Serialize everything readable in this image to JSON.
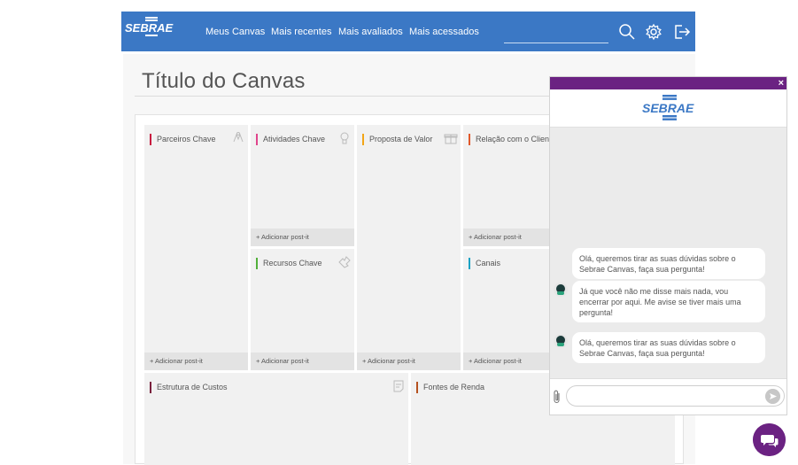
{
  "brand": {
    "logo_text": "SEBRAE",
    "color": "#3b78c5"
  },
  "nav": {
    "items": [
      {
        "label": "Meus Canvas"
      },
      {
        "label": "Mais recentes"
      },
      {
        "label": "Mais avaliados"
      },
      {
        "label": "Mais acessados"
      }
    ],
    "search_placeholder": ""
  },
  "icons": {
    "search": "search-icon",
    "settings": "gear-icon",
    "logout": "logout-icon"
  },
  "canvas": {
    "title": "Título do Canvas",
    "add_label": "+ Adicionar post-it",
    "blocks": {
      "parceiros": {
        "label": "Parceiros Chave",
        "color": "#c8173f"
      },
      "atividades": {
        "label": "Atividades Chave",
        "color": "#e0458c"
      },
      "proposta": {
        "label": "Proposta de Valor",
        "color": "#f2a516"
      },
      "relacao": {
        "label": "Relação com o Cliente",
        "color": "#e1592b"
      },
      "recursos": {
        "label": "Recursos Chave",
        "color": "#52b03a"
      },
      "canais": {
        "label": "Canais",
        "color": "#1ba2c4"
      },
      "custos": {
        "label": "Estrutura de Custos",
        "color": "#7a1f3d"
      },
      "fontes": {
        "label": "Fontes de Renda",
        "color": "#b5511f"
      }
    }
  },
  "chat": {
    "logo_text": "SEBRAE",
    "header_color": "#6b2282",
    "close_label": "×",
    "messages": [
      {
        "text": "Olá, queremos tirar as suas dúvidas sobre o Sebrae Canvas, faça sua pergunta!"
      },
      {
        "text": "Já que você não me disse mais nada, vou encerrar por aqui. Me avise se tiver mais uma pergunta!"
      },
      {
        "text": "Olá, queremos tirar as suas dúvidas sobre o Sebrae Canvas, faça sua pergunta!"
      }
    ],
    "input_placeholder": ""
  }
}
